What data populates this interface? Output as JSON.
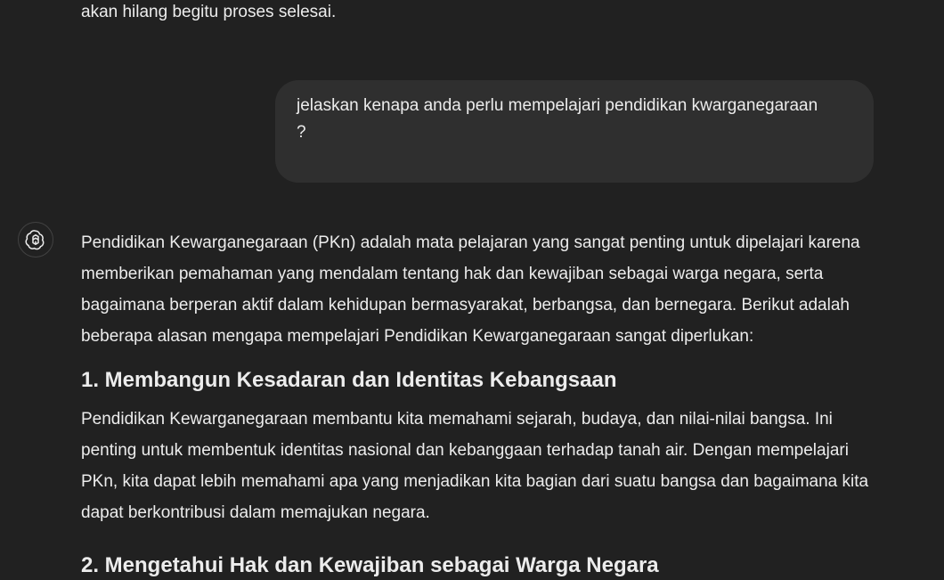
{
  "conversation": {
    "previous_tail": "akan hilang begitu proses selesai.",
    "user_message": "jelaskan kenapa anda perlu mempelajari pendidikan kwarganegaraan\n?",
    "assistant": {
      "avatar_icon": "openai-logo-icon",
      "intro": "Pendidikan Kewarganegaraan (PKn) adalah mata pelajaran yang sangat penting untuk dipelajari karena memberikan pemahaman yang mendalam tentang hak dan kewajiban sebagai warga negara, serta bagaimana berperan aktif dalam kehidupan bermasyarakat, berbangsa, dan bernegara. Berikut adalah beberapa alasan mengapa mempelajari Pendidikan Kewarganegaraan sangat diperlukan:",
      "sections": [
        {
          "heading": "1. Membangun Kesadaran dan Identitas Kebangsaan",
          "body": "Pendidikan Kewarganegaraan membantu kita memahami sejarah, budaya, dan nilai-nilai bangsa. Ini penting untuk membentuk identitas nasional dan kebanggaan terhadap tanah air. Dengan mempelajari PKn, kita dapat lebih memahami apa yang menjadikan kita bagian dari suatu bangsa dan bagaimana kita dapat berkontribusi dalam memajukan negara."
        },
        {
          "heading": "2. Mengetahui Hak dan Kewajiban sebagai Warga Negara"
        }
      ]
    }
  },
  "colors": {
    "background": "#212121",
    "user_bubble": "#2f2f2f",
    "text": "#ececec"
  }
}
